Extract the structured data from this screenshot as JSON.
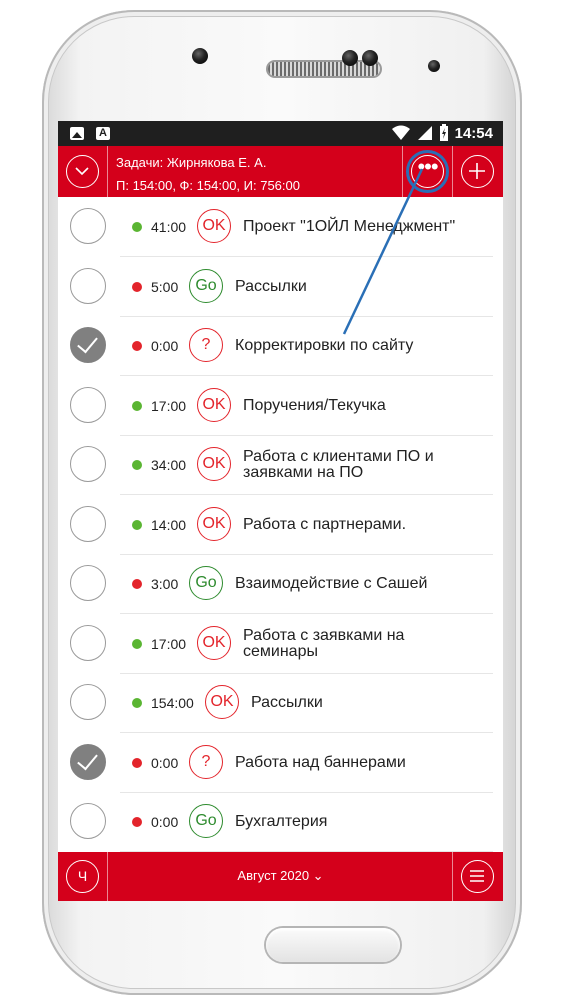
{
  "status_bar": {
    "time": "14:54",
    "icons": [
      "image-icon",
      "a-icon",
      "wifi-icon",
      "signal-icon",
      "battery-charging-icon"
    ]
  },
  "header": {
    "line1": "Задачи: Жирнякова Е. А.",
    "line2": "П: 154:00, Ф: 154:00, И: 756:00",
    "icons": [
      "chevron-down-icon",
      "more-icon",
      "add-icon"
    ]
  },
  "tasks": [
    {
      "done": false,
      "dot_color": "#5ab532",
      "duration": "41:00",
      "badge": "OK",
      "title_l1": "Проект \"1ОЙЛ Менеджмент\"",
      "title_l2": ""
    },
    {
      "done": false,
      "dot_color": "#e3242b",
      "duration": "5:00",
      "badge": "Go",
      "title_l1": "Рассылки",
      "title_l2": ""
    },
    {
      "done": true,
      "dot_color": "#e3242b",
      "duration": "0:00",
      "badge": "?",
      "title_l1": "Корректировки по сайту",
      "title_l2": ""
    },
    {
      "done": false,
      "dot_color": "#5ab532",
      "duration": "17:00",
      "badge": "OK",
      "title_l1": "Поручения/Текучка",
      "title_l2": ""
    },
    {
      "done": false,
      "dot_color": "#5ab532",
      "duration": "34:00",
      "badge": "OK",
      "title_l1": "Работа с клиентами ПО и",
      "title_l2": "заявками на ПО"
    },
    {
      "done": false,
      "dot_color": "#5ab532",
      "duration": "14:00",
      "badge": "OK",
      "title_l1": "Работа с партнерами.",
      "title_l2": ""
    },
    {
      "done": false,
      "dot_color": "#e3242b",
      "duration": "3:00",
      "badge": "Go",
      "title_l1": "Взаимодействие с Сашей",
      "title_l2": ""
    },
    {
      "done": false,
      "dot_color": "#5ab532",
      "duration": "17:00",
      "badge": "OK",
      "title_l1": "Работа с заявками на",
      "title_l2": "семинары"
    },
    {
      "done": false,
      "dot_color": "#5ab532",
      "duration": "154:00",
      "badge": "OK",
      "title_l1": "Рассылки",
      "title_l2": ""
    },
    {
      "done": true,
      "dot_color": "#e3242b",
      "duration": "0:00",
      "badge": "?",
      "title_l1": "Работа над баннерами",
      "title_l2": ""
    },
    {
      "done": false,
      "dot_color": "#e3242b",
      "duration": "0:00",
      "badge": "Go",
      "title_l1": "Бухгалтерия",
      "title_l2": ""
    }
  ],
  "footer": {
    "left_label": "Ч",
    "month": "Август 2020 ⌄",
    "icons": [
      "menu-icon"
    ]
  },
  "colors": {
    "brand_red": "#d4001b",
    "ok_red": "#e3242b",
    "go_green": "#2e8b2e",
    "highlight_blue": "#2a6fb6"
  }
}
